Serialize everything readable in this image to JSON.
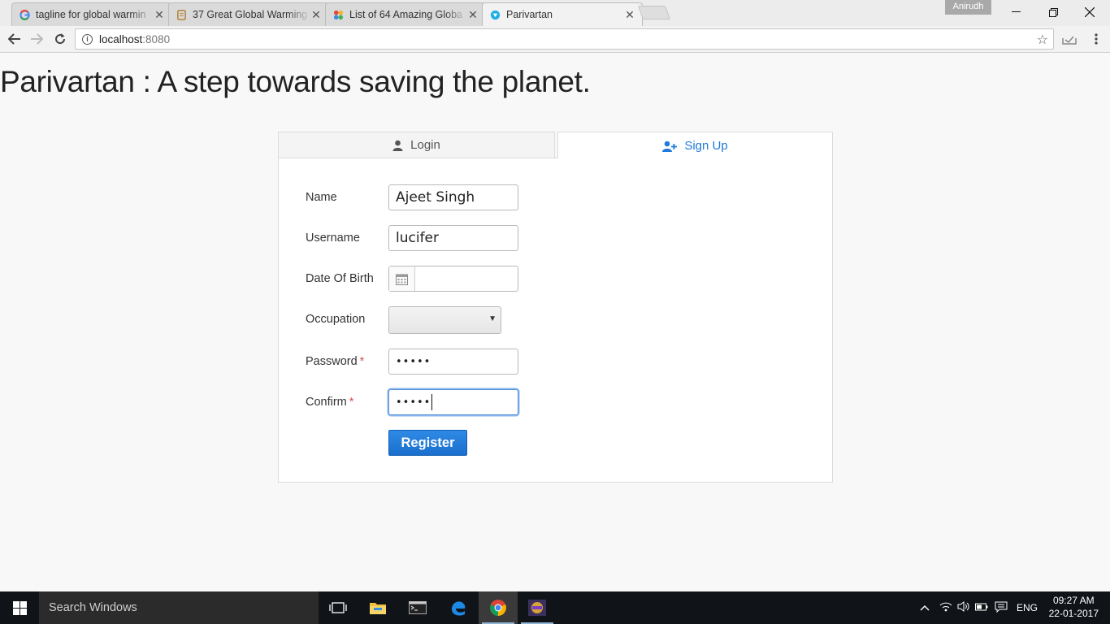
{
  "browser": {
    "tabs": [
      {
        "title": "tagline for global warmin",
        "icon": "google-icon"
      },
      {
        "title": "37 Great Global Warming",
        "icon": "document-icon"
      },
      {
        "title": "List of 64 Amazing Globa",
        "icon": "pinwheel-icon"
      },
      {
        "title": "Parivartan",
        "icon": "parivartan-icon",
        "active": true
      }
    ],
    "profile_name": "Anirudh",
    "url_host": "localhost",
    "url_port": ":8080"
  },
  "page": {
    "title": "Parivartan : A step towards saving the planet.",
    "tabs": {
      "login": "Login",
      "signup": "Sign Up"
    },
    "form": {
      "name_label": "Name",
      "name_value": "Ajeet Singh",
      "username_label": "Username",
      "username_value": "lucifer",
      "dob_label": "Date Of Birth",
      "dob_value": "",
      "occupation_label": "Occupation",
      "occupation_value": "",
      "password_label": "Password",
      "password_value": "•••••",
      "confirm_label": "Confirm",
      "confirm_value": "•••••",
      "required_mark": "*",
      "register_label": "Register"
    }
  },
  "taskbar": {
    "search_placeholder": "Search Windows",
    "language": "ENG",
    "time": "09:27 AM",
    "date": "22-01-2017"
  },
  "colors": {
    "accent": "#1f7ad8",
    "required": "#d9534f",
    "taskbar": "#101418"
  }
}
